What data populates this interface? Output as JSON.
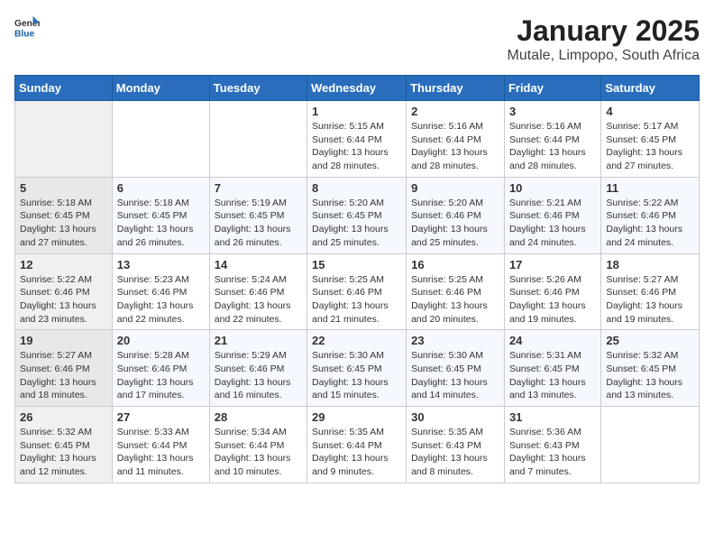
{
  "logo": {
    "text1": "General",
    "text2": "Blue"
  },
  "title": "January 2025",
  "subtitle": "Mutale, Limpopo, South Africa",
  "days_of_week": [
    "Sunday",
    "Monday",
    "Tuesday",
    "Wednesday",
    "Thursday",
    "Friday",
    "Saturday"
  ],
  "weeks": [
    [
      {
        "day": "",
        "content": ""
      },
      {
        "day": "",
        "content": ""
      },
      {
        "day": "",
        "content": ""
      },
      {
        "day": "1",
        "content": "Sunrise: 5:15 AM\nSunset: 6:44 PM\nDaylight: 13 hours\nand 28 minutes."
      },
      {
        "day": "2",
        "content": "Sunrise: 5:16 AM\nSunset: 6:44 PM\nDaylight: 13 hours\nand 28 minutes."
      },
      {
        "day": "3",
        "content": "Sunrise: 5:16 AM\nSunset: 6:44 PM\nDaylight: 13 hours\nand 28 minutes."
      },
      {
        "day": "4",
        "content": "Sunrise: 5:17 AM\nSunset: 6:45 PM\nDaylight: 13 hours\nand 27 minutes."
      }
    ],
    [
      {
        "day": "5",
        "content": "Sunrise: 5:18 AM\nSunset: 6:45 PM\nDaylight: 13 hours\nand 27 minutes."
      },
      {
        "day": "6",
        "content": "Sunrise: 5:18 AM\nSunset: 6:45 PM\nDaylight: 13 hours\nand 26 minutes."
      },
      {
        "day": "7",
        "content": "Sunrise: 5:19 AM\nSunset: 6:45 PM\nDaylight: 13 hours\nand 26 minutes."
      },
      {
        "day": "8",
        "content": "Sunrise: 5:20 AM\nSunset: 6:45 PM\nDaylight: 13 hours\nand 25 minutes."
      },
      {
        "day": "9",
        "content": "Sunrise: 5:20 AM\nSunset: 6:46 PM\nDaylight: 13 hours\nand 25 minutes."
      },
      {
        "day": "10",
        "content": "Sunrise: 5:21 AM\nSunset: 6:46 PM\nDaylight: 13 hours\nand 24 minutes."
      },
      {
        "day": "11",
        "content": "Sunrise: 5:22 AM\nSunset: 6:46 PM\nDaylight: 13 hours\nand 24 minutes."
      }
    ],
    [
      {
        "day": "12",
        "content": "Sunrise: 5:22 AM\nSunset: 6:46 PM\nDaylight: 13 hours\nand 23 minutes."
      },
      {
        "day": "13",
        "content": "Sunrise: 5:23 AM\nSunset: 6:46 PM\nDaylight: 13 hours\nand 22 minutes."
      },
      {
        "day": "14",
        "content": "Sunrise: 5:24 AM\nSunset: 6:46 PM\nDaylight: 13 hours\nand 22 minutes."
      },
      {
        "day": "15",
        "content": "Sunrise: 5:25 AM\nSunset: 6:46 PM\nDaylight: 13 hours\nand 21 minutes."
      },
      {
        "day": "16",
        "content": "Sunrise: 5:25 AM\nSunset: 6:46 PM\nDaylight: 13 hours\nand 20 minutes."
      },
      {
        "day": "17",
        "content": "Sunrise: 5:26 AM\nSunset: 6:46 PM\nDaylight: 13 hours\nand 19 minutes."
      },
      {
        "day": "18",
        "content": "Sunrise: 5:27 AM\nSunset: 6:46 PM\nDaylight: 13 hours\nand 19 minutes."
      }
    ],
    [
      {
        "day": "19",
        "content": "Sunrise: 5:27 AM\nSunset: 6:46 PM\nDaylight: 13 hours\nand 18 minutes."
      },
      {
        "day": "20",
        "content": "Sunrise: 5:28 AM\nSunset: 6:46 PM\nDaylight: 13 hours\nand 17 minutes."
      },
      {
        "day": "21",
        "content": "Sunrise: 5:29 AM\nSunset: 6:46 PM\nDaylight: 13 hours\nand 16 minutes."
      },
      {
        "day": "22",
        "content": "Sunrise: 5:30 AM\nSunset: 6:45 PM\nDaylight: 13 hours\nand 15 minutes."
      },
      {
        "day": "23",
        "content": "Sunrise: 5:30 AM\nSunset: 6:45 PM\nDaylight: 13 hours\nand 14 minutes."
      },
      {
        "day": "24",
        "content": "Sunrise: 5:31 AM\nSunset: 6:45 PM\nDaylight: 13 hours\nand 13 minutes."
      },
      {
        "day": "25",
        "content": "Sunrise: 5:32 AM\nSunset: 6:45 PM\nDaylight: 13 hours\nand 13 minutes."
      }
    ],
    [
      {
        "day": "26",
        "content": "Sunrise: 5:32 AM\nSunset: 6:45 PM\nDaylight: 13 hours\nand 12 minutes."
      },
      {
        "day": "27",
        "content": "Sunrise: 5:33 AM\nSunset: 6:44 PM\nDaylight: 13 hours\nand 11 minutes."
      },
      {
        "day": "28",
        "content": "Sunrise: 5:34 AM\nSunset: 6:44 PM\nDaylight: 13 hours\nand 10 minutes."
      },
      {
        "day": "29",
        "content": "Sunrise: 5:35 AM\nSunset: 6:44 PM\nDaylight: 13 hours\nand 9 minutes."
      },
      {
        "day": "30",
        "content": "Sunrise: 5:35 AM\nSunset: 6:43 PM\nDaylight: 13 hours\nand 8 minutes."
      },
      {
        "day": "31",
        "content": "Sunrise: 5:36 AM\nSunset: 6:43 PM\nDaylight: 13 hours\nand 7 minutes."
      },
      {
        "day": "",
        "content": ""
      }
    ]
  ]
}
